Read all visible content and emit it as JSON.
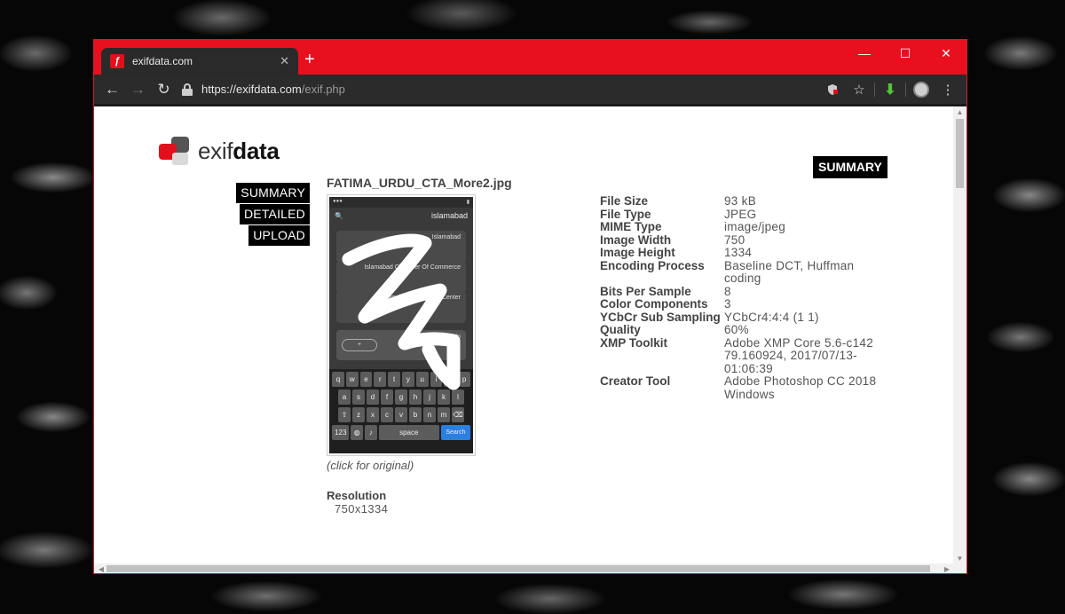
{
  "browser": {
    "tab_title": "exifdata.com",
    "tab_favicon": "ƒ",
    "tab_close": "✕",
    "new_tab": "+",
    "url_host": "https://exifdata.com",
    "url_path": "/exif.php",
    "win_minimize": "—",
    "win_maximize": "☐",
    "win_close": "✕",
    "back": "←",
    "forward": "→",
    "reload": "↻",
    "colors": {
      "frame": "#e8101e",
      "toolbar": "#2b2b2b"
    }
  },
  "logo": {
    "text_light": "exif",
    "text_bold": "data"
  },
  "menu": {
    "items": [
      {
        "label": "SUMMARY"
      },
      {
        "label": "DETAILED"
      },
      {
        "label": "UPLOAD"
      }
    ],
    "summary_top": "SUMMARY"
  },
  "file": {
    "name": "FATIMA_URDU_CTA_More2.jpg",
    "click_hint": "(click for original)",
    "resolution_label": "Resolution",
    "resolution_value": "750x1334"
  },
  "phone_preview": {
    "header_title": "islamabad",
    "cards": [
      "Islamabad",
      "Islamabad Chamber Of Commerce",
      "Islamabad Diagnostic Center"
    ],
    "bar_text": "Hussain",
    "keys_row1": [
      "q",
      "w",
      "e",
      "r",
      "t",
      "y",
      "u",
      "i",
      "o",
      "p"
    ],
    "keys_row2": [
      "a",
      "s",
      "d",
      "f",
      "g",
      "h",
      "j",
      "k",
      "l"
    ],
    "keys_row3": [
      "⇧",
      "z",
      "x",
      "c",
      "v",
      "b",
      "n",
      "m",
      "⌫"
    ],
    "space": "space",
    "search": "Search",
    "num_key": "123"
  },
  "metadata": [
    {
      "key": "File Size",
      "value": "93 kB"
    },
    {
      "key": "File Type",
      "value": "JPEG"
    },
    {
      "key": "MIME Type",
      "value": "image/jpeg"
    },
    {
      "key": "Image Width",
      "value": "750"
    },
    {
      "key": "Image Height",
      "value": "1334"
    },
    {
      "key": "Encoding Process",
      "value": "Baseline DCT, Huffman coding"
    },
    {
      "key": "Bits Per Sample",
      "value": "8"
    },
    {
      "key": "Color Components",
      "value": "3"
    },
    {
      "key": "YCbCr Sub Sampling",
      "value": "YCbCr4:4:4 (1 1)"
    },
    {
      "key": "Quality",
      "value": "60%"
    },
    {
      "key": "XMP Toolkit",
      "value": "Adobe XMP Core 5.6-c142 79.160924, 2017/07/13-01:06:39"
    },
    {
      "key": "Creator Tool",
      "value": "Adobe Photoshop CC 2018 Windows"
    }
  ]
}
